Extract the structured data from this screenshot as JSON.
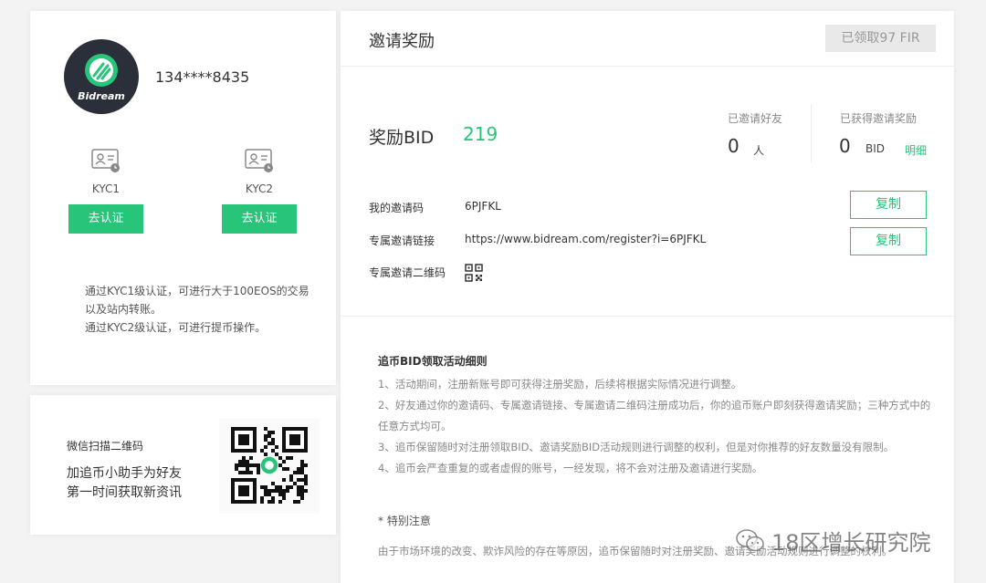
{
  "profile": {
    "avatar_brand": "Bidream",
    "phone": "134****8435"
  },
  "kyc": {
    "items": [
      {
        "label": "KYC1",
        "button": "去认证"
      },
      {
        "label": "KYC2",
        "button": "去认证"
      }
    ],
    "notes": [
      "通过KYC1级认证，可进行大于100EOS的交易以及站内转账。",
      "通过KYC2级认证，可进行提币操作。"
    ]
  },
  "wechat": {
    "title": "微信扫描二维码",
    "line1": "加追币小助手为好友",
    "line2": "第一时间获取新资讯"
  },
  "header": {
    "title": "邀请奖励",
    "claimed_button": "已领取97 FIR"
  },
  "reward": {
    "label": "奖励BID",
    "value": "219",
    "invited_label": "已邀请好友",
    "invited_count": "0",
    "invited_unit": "人",
    "earned_label": "已获得邀请奖励",
    "earned_amount": "0",
    "earned_unit": "BID",
    "detail_link": "明细"
  },
  "invite": {
    "code_label": "我的邀请码",
    "code_value": "6PJFKL",
    "link_label": "专属邀请链接",
    "link_value": "https://www.bidream.com/register?i=6PJFKL",
    "qr_label": "专属邀请二维码",
    "copy_label": "复制"
  },
  "rules": {
    "title": "追币BID领取活动细则",
    "items": [
      "1、活动期间，注册新账号即可获得注册奖励，后续将根据实际情况进行调整。",
      "2、好友通过你的邀请码、专属邀请链接、专属邀请二维码注册成功后，你的追币账户即刻获得邀请奖励；三种方式中的任意方式均可。",
      "3、追币保留随时对注册领取BID、邀请奖励BID活动规则进行调整的权利，但是对你推荐的好友数量没有限制。",
      "4、追币会严查重复的或者虚假的账号，一经发现，将不会对注册及邀请进行奖励。"
    ],
    "note_title": "* 特别注意",
    "note_text": "由于市场环境的改变、欺诈风险的存在等原因，追币保留随时对注册奖励、邀请奖励活动规则进行调整的权利。"
  },
  "watermark": {
    "text": "18区增长研究院"
  },
  "colors": {
    "accent": "#27c47a",
    "avatar_bg": "#2b2f3a",
    "page_bg": "#f3f3f3"
  }
}
